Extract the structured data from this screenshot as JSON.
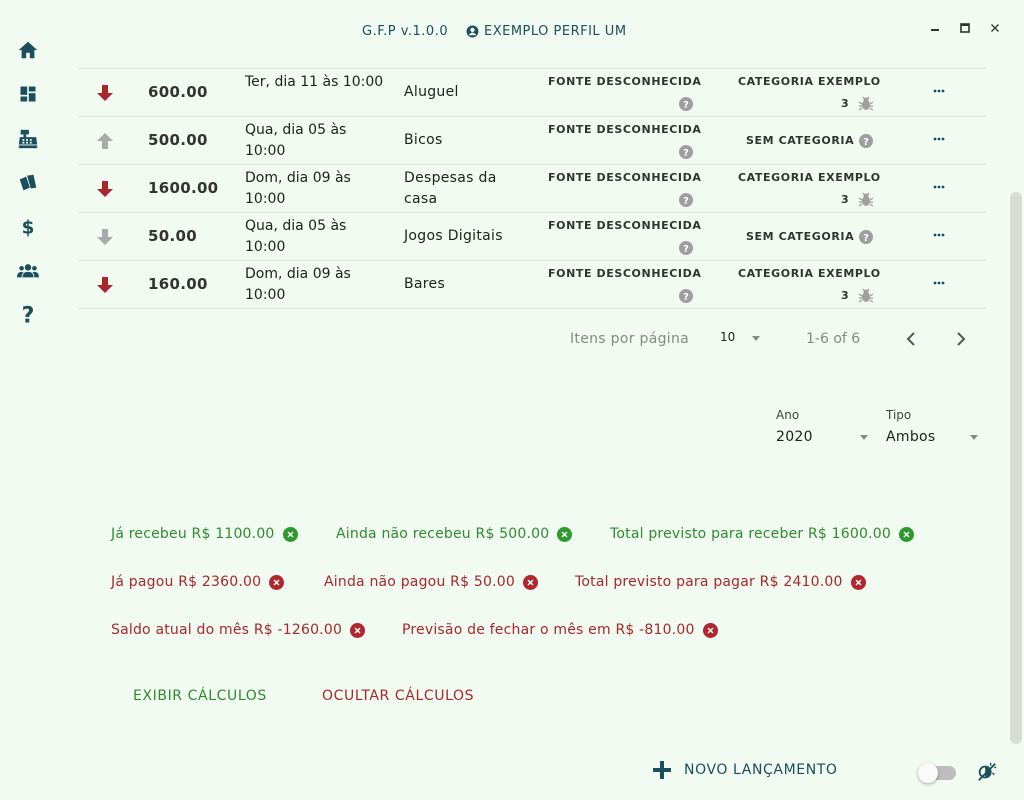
{
  "app": {
    "title": "G.F.P v.1.0.0",
    "profile": "EXEMPLO PERFIL UM"
  },
  "sidebar": {
    "items": [
      {
        "icon": "home-icon",
        "label": "home"
      },
      {
        "icon": "dashboard-icon",
        "label": "dashboard"
      },
      {
        "icon": "cash-register-icon",
        "label": "cash-register"
      },
      {
        "icon": "cards-icon",
        "label": "cards"
      },
      {
        "icon": "dollar-icon",
        "label": "dollar"
      },
      {
        "icon": "people-icon",
        "label": "people"
      },
      {
        "icon": "help-icon",
        "label": "help"
      }
    ]
  },
  "table": {
    "rows": [
      {
        "direction": "down",
        "amount": "600.00",
        "date": "Ter, dia 11 às 10:00",
        "description": "Aluguel",
        "source": "FONTE DESCONHECIDA",
        "category": "CATEGORIA EXEMPLO",
        "category_count": "3",
        "has_category": true
      },
      {
        "direction": "up",
        "amount": "500.00",
        "date": "Qua, dia 05 às 10:00",
        "description": "Bicos",
        "source": "FONTE DESCONHECIDA",
        "category": "SEM CATEGORIA",
        "category_count": "",
        "has_category": false
      },
      {
        "direction": "down",
        "amount": "1600.00",
        "date": "Dom, dia 09 às 10:00",
        "description": "Despesas da casa",
        "source": "FONTE DESCONHECIDA",
        "category": "CATEGORIA EXEMPLO",
        "category_count": "3",
        "has_category": true
      },
      {
        "direction": "down-gray",
        "amount": "50.00",
        "date": "Qua, dia 05 às 10:00",
        "description": "Jogos Digitais",
        "source": "FONTE DESCONHECIDA",
        "category": "SEM CATEGORIA",
        "category_count": "",
        "has_category": false
      },
      {
        "direction": "down",
        "amount": "160.00",
        "date": "Dom, dia 09 às 10:00",
        "description": "Bares",
        "source": "FONTE DESCONHECIDA",
        "category": "CATEGORIA EXEMPLO",
        "category_count": "3",
        "has_category": true
      }
    ]
  },
  "pagination": {
    "label": "Itens por página",
    "per_page": "10",
    "range": "1-6 of 6"
  },
  "filters": {
    "year_label": "Ano",
    "year_value": "2020",
    "type_label": "Tipo",
    "type_value": "Ambos"
  },
  "summary": {
    "received": "Já recebeu R$ 1100.00",
    "not_received": "Ainda não recebeu R$ 500.00",
    "total_receive": "Total previsto para receber R$ 1600.00",
    "paid": "Já pagou R$ 2360.00",
    "not_paid": "Ainda não pagou R$ 50.00",
    "total_pay": "Total previsto para pagar R$ 2410.00",
    "balance": "Saldo atual do mês R$ -1260.00",
    "forecast": "Previsão de fechar o mês em R$ -810.00"
  },
  "actions": {
    "show_calc": "EXIBIR CÁLCULOS",
    "hide_calc": "OCULTAR CÁLCULOS",
    "new_entry": "NOVO LANÇAMENTO"
  },
  "colors": {
    "background": "#f1fbf1",
    "primary": "#1b4f5c",
    "income": "#2e8b2e",
    "expense": "#a8272d"
  }
}
